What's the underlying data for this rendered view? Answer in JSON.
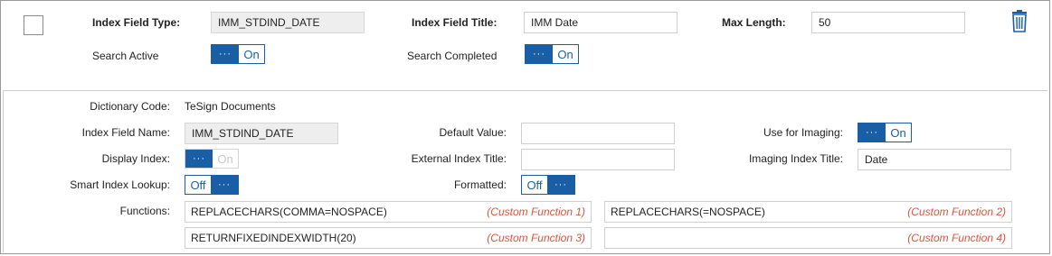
{
  "header": {
    "index_field_type_label": "Index Field Type:",
    "index_field_type_value": "IMM_STDIND_DATE",
    "index_field_title_label": "Index Field Title:",
    "index_field_title_value": "IMM Date",
    "max_length_label": "Max Length:",
    "max_length_value": "50",
    "search_active_label": "Search Active",
    "search_active_state": "On",
    "search_completed_label": "Search Completed",
    "search_completed_state": "On"
  },
  "details": {
    "dictionary_code_label": "Dictionary Code:",
    "dictionary_code_value": "TeSign Documents",
    "index_field_name_label": "Index Field Name:",
    "index_field_name_value": "IMM_STDIND_DATE",
    "default_value_label": "Default Value:",
    "default_value_value": "",
    "use_for_imaging_label": "Use for Imaging:",
    "use_for_imaging_state": "On",
    "display_index_label": "Display Index:",
    "display_index_state": "On",
    "external_index_title_label": "External Index Title:",
    "external_index_title_value": "",
    "imaging_index_title_label": "Imaging Index Title:",
    "imaging_index_title_value": "Date",
    "smart_index_lookup_label": "Smart Index Lookup:",
    "smart_index_lookup_state": "Off",
    "formatted_label": "Formatted:",
    "formatted_state": "Off",
    "functions_label": "Functions:",
    "functions": [
      {
        "value": "REPLACECHARS(COMMA=NOSPACE)",
        "hint": "(Custom Function 1)"
      },
      {
        "value": "REPLACECHARS(=NOSPACE)",
        "hint": "(Custom Function 2)"
      },
      {
        "value": "RETURNFIXEDINDEXWIDTH(20)",
        "hint": "(Custom Function 3)"
      },
      {
        "value": "",
        "hint": "(Custom Function 4)"
      }
    ]
  },
  "toggle_knob_glyph": "···",
  "colors": {
    "accent": "#1a5fa6",
    "hint": "#e0533d"
  },
  "icons": {
    "trash": "trash-icon"
  }
}
